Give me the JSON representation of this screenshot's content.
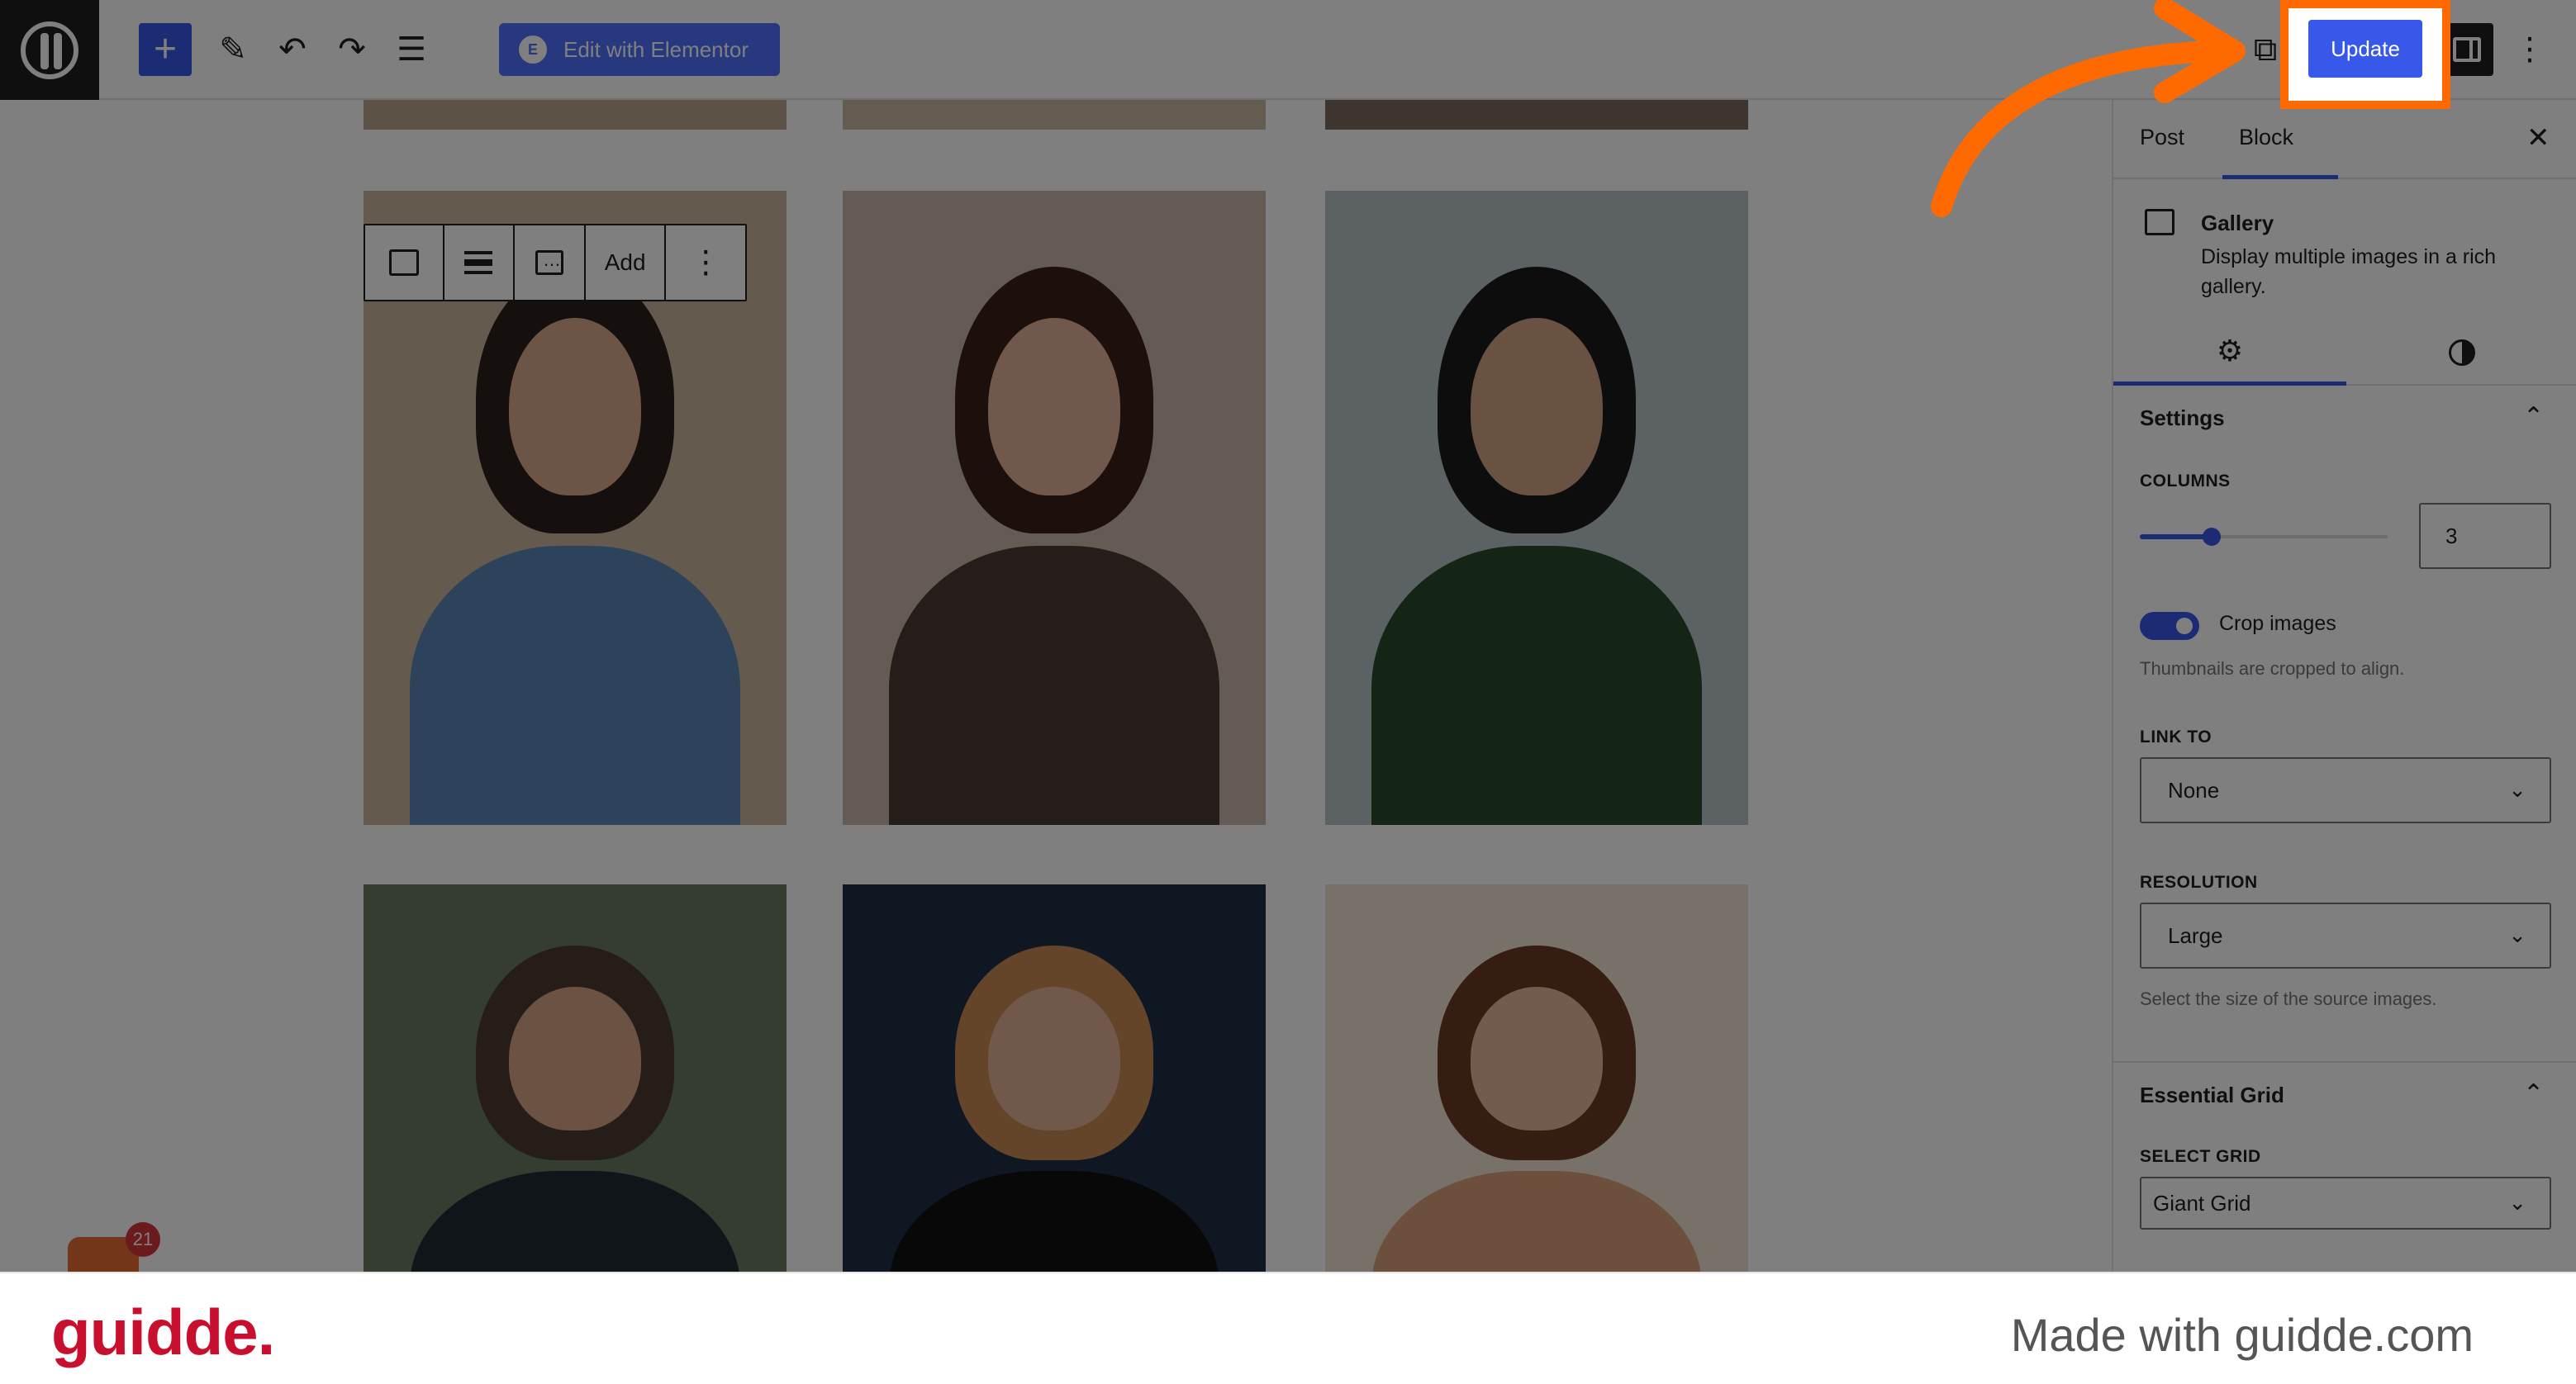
{
  "topbar": {
    "add_block_icon": "plus-icon",
    "edit_with_elementor": "Edit with Elementor",
    "update_label": "Update"
  },
  "block_toolbar": {
    "add_label": "Add"
  },
  "sidebar": {
    "tab_post": "Post",
    "tab_block": "Block",
    "block_title": "Gallery",
    "block_description": "Display multiple images in a rich gallery.",
    "settings": {
      "title": "Settings",
      "columns_label": "COLUMNS",
      "columns_value": "3",
      "columns_level_fraction": 0.29,
      "crop_images_label": "Crop images",
      "crop_images_on": true,
      "crop_help": "Thumbnails are cropped to align.",
      "link_to_label": "LINK TO",
      "link_to_value": "None",
      "resolution_label": "RESOLUTION",
      "resolution_value": "Large",
      "resolution_help": "Select the size of the source images."
    },
    "essential_grid": {
      "title": "Essential Grid",
      "select_grid_label": "SELECT GRID",
      "select_grid_value": "Giant Grid"
    }
  },
  "gallery": {
    "photos": [
      {
        "name": "photo-woman-blue-shawl",
        "bg": "#c9b59a",
        "hair": "#2a211b",
        "skin": "#d8a98c",
        "cloth": "#5b86b8"
      },
      {
        "name": "photo-woman-brown-jacket",
        "bg": "#c6b7a8",
        "hair": "#3a1e16",
        "skin": "#e2b09a",
        "cloth": "#4b3a33"
      },
      {
        "name": "photo-person-stairs",
        "bg": "#b9c2c6",
        "hair": "#1a1a1a",
        "skin": "#d4a486",
        "cloth": "#2b4a2a"
      },
      {
        "name": "photo-woman-smiling-curly",
        "bg": "#6b7a60",
        "hair": "#4d3b30",
        "skin": "#d9a486",
        "cloth": "#1f2a30"
      },
      {
        "name": "photo-woman-lake-dusk",
        "bg": "#1e3044",
        "hair": "#c98a54",
        "skin": "#e0b394",
        "cloth": "#111111"
      },
      {
        "name": "photo-closeup-curly-hair",
        "bg": "#f1e3d2",
        "hair": "#6b3d23",
        "skin": "#e7b79a",
        "cloth": "#d9a07a"
      }
    ]
  },
  "shop": {
    "count": "21"
  },
  "footer": {
    "brand": "guidde.",
    "tagline": "Made with guidde.com"
  },
  "colors": {
    "accent": "#3858e9",
    "highlight": "#ff6a00",
    "brand_red": "#c8102e"
  }
}
